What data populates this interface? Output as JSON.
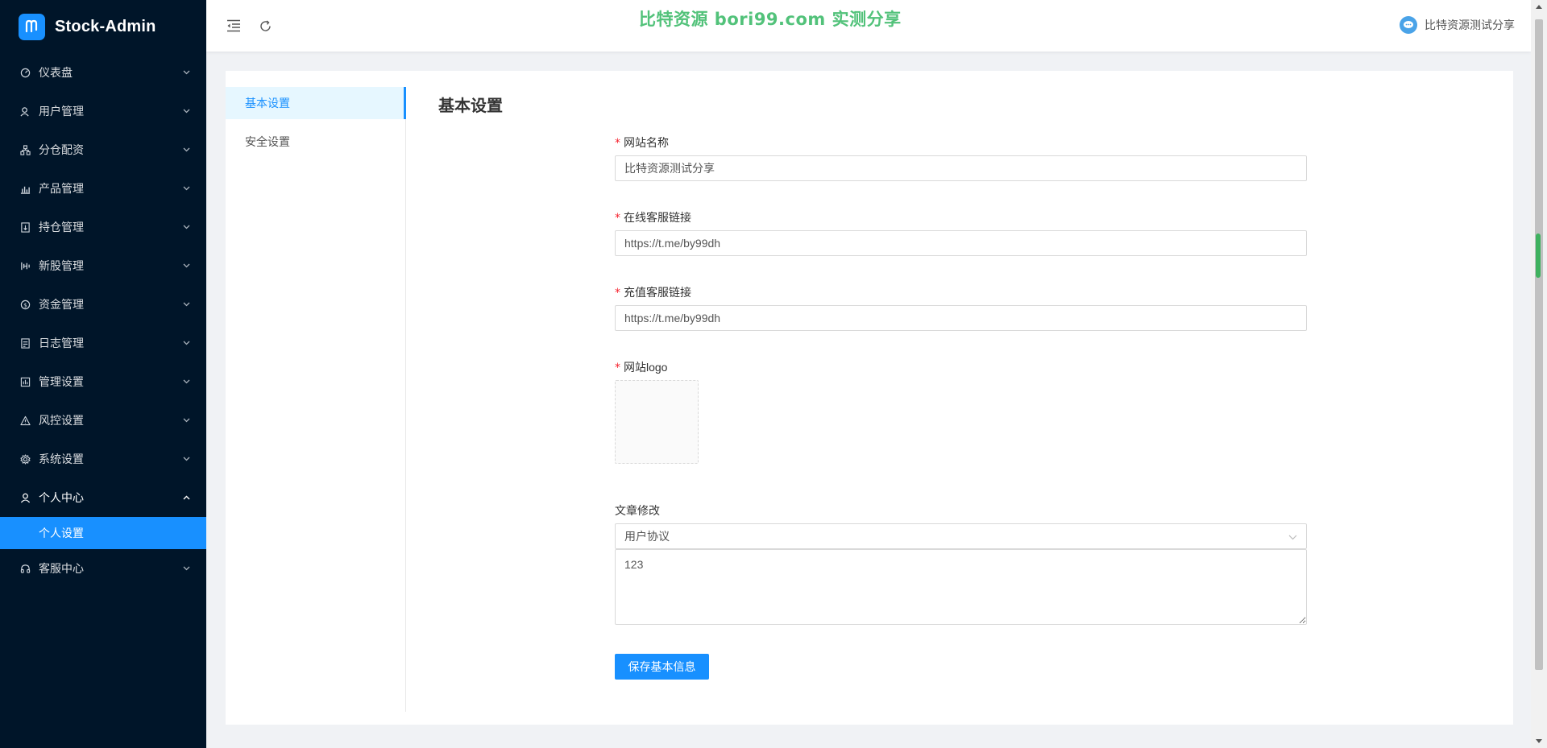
{
  "app": {
    "title": "Stock-Admin"
  },
  "sidebar": {
    "items": [
      {
        "label": "仪表盘",
        "icon": "dashboard-icon"
      },
      {
        "label": "用户管理",
        "icon": "user-manage-icon"
      },
      {
        "label": "分仓配资",
        "icon": "org-chart-icon"
      },
      {
        "label": "产品管理",
        "icon": "bar-chart-icon"
      },
      {
        "label": "持仓管理",
        "icon": "position-icon"
      },
      {
        "label": "新股管理",
        "icon": "ipo-icon"
      },
      {
        "label": "资金管理",
        "icon": "money-icon"
      },
      {
        "label": "日志管理",
        "icon": "log-icon"
      },
      {
        "label": "管理设置",
        "icon": "admin-settings-icon"
      },
      {
        "label": "风控设置",
        "icon": "warning-icon"
      },
      {
        "label": "系统设置",
        "icon": "gear-icon"
      },
      {
        "label": "个人中心",
        "icon": "person-icon",
        "open": true
      },
      {
        "label": "客服中心",
        "icon": "headset-icon"
      }
    ],
    "sub_item": {
      "label": "个人设置",
      "active": true
    }
  },
  "header": {
    "watermark": "比特资源 bori99.com 实测分享",
    "user_name": "比特资源测试分享"
  },
  "settings_menu": {
    "items": [
      {
        "label": "基本设置",
        "active": true
      },
      {
        "label": "安全设置",
        "active": false
      }
    ]
  },
  "main": {
    "title": "基本设置",
    "fields": {
      "site_name": {
        "label": "网站名称",
        "value": "比特资源测试分享",
        "required": true
      },
      "online_service": {
        "label": "在线客服链接",
        "value": "https://t.me/by99dh",
        "required": true
      },
      "recharge_service": {
        "label": "充值客服链接",
        "value": "https://t.me/by99dh",
        "required": true
      },
      "logo": {
        "label": "网站logo",
        "required": true
      },
      "article": {
        "label": "文章修改",
        "selected": "用户协议",
        "content": "123"
      }
    },
    "save_label": "保存基本信息"
  },
  "colors": {
    "sidebar_bg": "#001529",
    "accent": "#1890ff",
    "watermark": "#52c27a"
  }
}
